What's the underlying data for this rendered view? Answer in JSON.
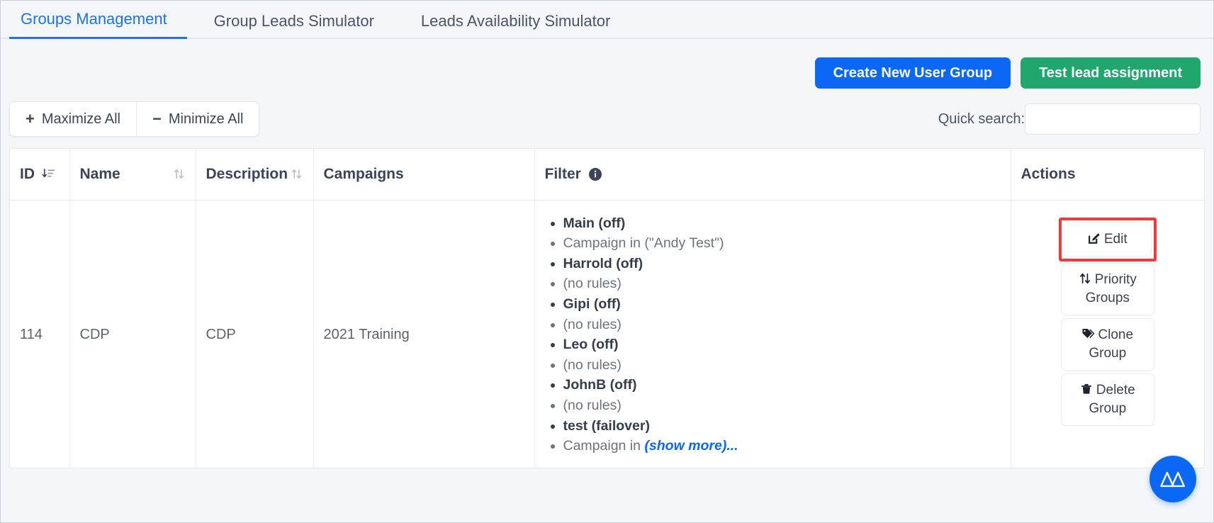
{
  "tabs": [
    {
      "label": "Groups Management",
      "active": true
    },
    {
      "label": "Group Leads Simulator",
      "active": false
    },
    {
      "label": "Leads Availability Simulator",
      "active": false
    }
  ],
  "toolbar": {
    "create_group_label": "Create New User Group",
    "test_assignment_label": "Test lead assignment",
    "maximize_label": "Maximize All",
    "minimize_label": "Minimize All",
    "maximize_symbol": "+",
    "minimize_symbol": "−"
  },
  "search": {
    "label": "Quick search:",
    "value": "",
    "placeholder": ""
  },
  "table": {
    "columns": [
      {
        "label": "ID",
        "sort": "sort-descending-icon",
        "sorted": true
      },
      {
        "label": "Name",
        "sort": "sort-both-icon",
        "sorted": false
      },
      {
        "label": "Description",
        "sort": "sort-both-icon",
        "sorted": false
      },
      {
        "label": "Campaigns",
        "sort": null,
        "sorted": false
      },
      {
        "label": "Filter",
        "sort": null,
        "sorted": false,
        "info": "info-icon"
      },
      {
        "label": "Actions",
        "sort": null,
        "sorted": false
      }
    ],
    "rows": [
      {
        "id": "114",
        "name": "CDP",
        "description": "CDP",
        "campaigns": "2021 Training",
        "filter": [
          {
            "text": "Main (off)",
            "type": "header"
          },
          {
            "text": "Campaign in (\"Andy Test\")",
            "type": "rule"
          },
          {
            "text": "Harrold (off)",
            "type": "header"
          },
          {
            "text": "(no rules)",
            "type": "rule"
          },
          {
            "text": "Gipi (off)",
            "type": "header"
          },
          {
            "text": "(no rules)",
            "type": "rule"
          },
          {
            "text": "Leo (off)",
            "type": "header"
          },
          {
            "text": "(no rules)",
            "type": "rule"
          },
          {
            "text": "JohnB (off)",
            "type": "header"
          },
          {
            "text": "(no rules)",
            "type": "rule"
          },
          {
            "text": "test (failover)",
            "type": "header"
          },
          {
            "text": "Campaign in ",
            "type": "rule",
            "link": "(show more)..."
          }
        ],
        "actions": [
          {
            "label": "Edit",
            "icon": "edit-pencil-icon",
            "highlighted": true
          },
          {
            "label": "Priority Groups",
            "icon": "sort-arrows-icon",
            "highlighted": false
          },
          {
            "label": "Clone Group",
            "icon": "tag-icon",
            "highlighted": false
          },
          {
            "label": "Delete Group",
            "icon": "trash-icon",
            "highlighted": false
          }
        ]
      }
    ]
  },
  "fab": {
    "icon": "mountain-logo-icon"
  },
  "colors": {
    "accent_blue": "#0a68f5",
    "accent_green": "#21a66e",
    "highlight_red": "#f4393c",
    "text_dark": "#3b4458",
    "text_muted": "#6b7280"
  }
}
